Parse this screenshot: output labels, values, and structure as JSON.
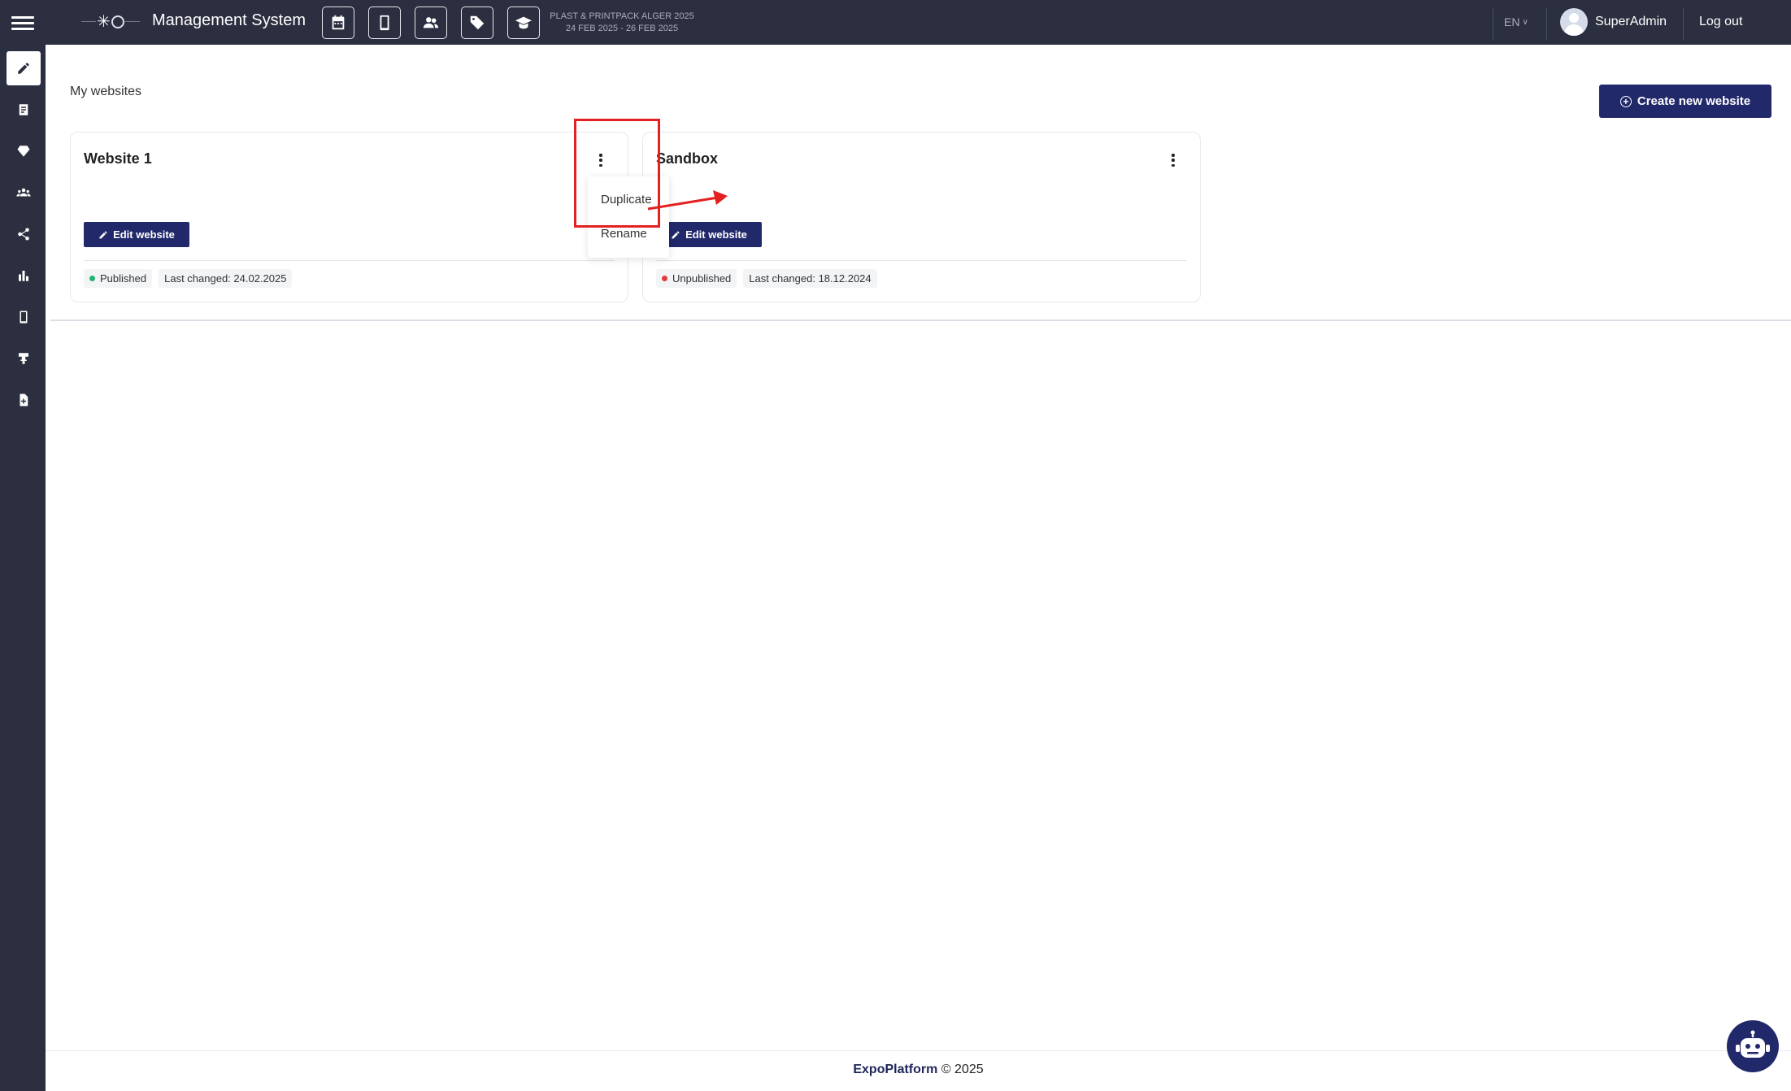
{
  "header": {
    "app_title": "Management System",
    "event_name": "PLAST & PRINTPACK ALGER 2025",
    "event_dates": "24 FEB 2025 - 26 FEB 2025",
    "language": "EN",
    "user_name": "SuperAdmin",
    "logout_label": "Log out",
    "shortcut_icons": [
      "calendar-icon",
      "mobile-icon",
      "people-icon",
      "tag-icon",
      "graduation-cap-icon"
    ]
  },
  "sidebar": {
    "items": [
      {
        "icon": "pencil-icon",
        "active": true
      },
      {
        "icon": "document-icon",
        "active": false
      },
      {
        "icon": "diamond-icon",
        "active": false
      },
      {
        "icon": "group-icon",
        "active": false
      },
      {
        "icon": "share-icon",
        "active": false
      },
      {
        "icon": "bar-chart-icon",
        "active": false
      },
      {
        "icon": "mobile-icon",
        "active": false
      },
      {
        "icon": "booth-icon",
        "active": false
      },
      {
        "icon": "file-plus-icon",
        "active": false
      }
    ]
  },
  "main": {
    "section_title": "My websites",
    "create_button_label": "Create new website",
    "websites": [
      {
        "name": "Website 1",
        "edit_label": "Edit website",
        "status": "Published",
        "status_color": "#22b573",
        "last_changed": "Last changed: 24.02.2025"
      },
      {
        "name": "Sandbox",
        "edit_label": "Edit website",
        "status": "Unpublished",
        "status_color": "#e23b3b",
        "last_changed": "Last changed: 18.12.2024"
      }
    ],
    "menu": {
      "items": [
        "Duplicate",
        "Rename"
      ]
    }
  },
  "footer": {
    "brand": "ExpoPlatform",
    "copyright": "© 2025"
  },
  "colors": {
    "topbar": "#2b2f3f",
    "primary_button": "#22296b",
    "annotation": "#e42020"
  }
}
